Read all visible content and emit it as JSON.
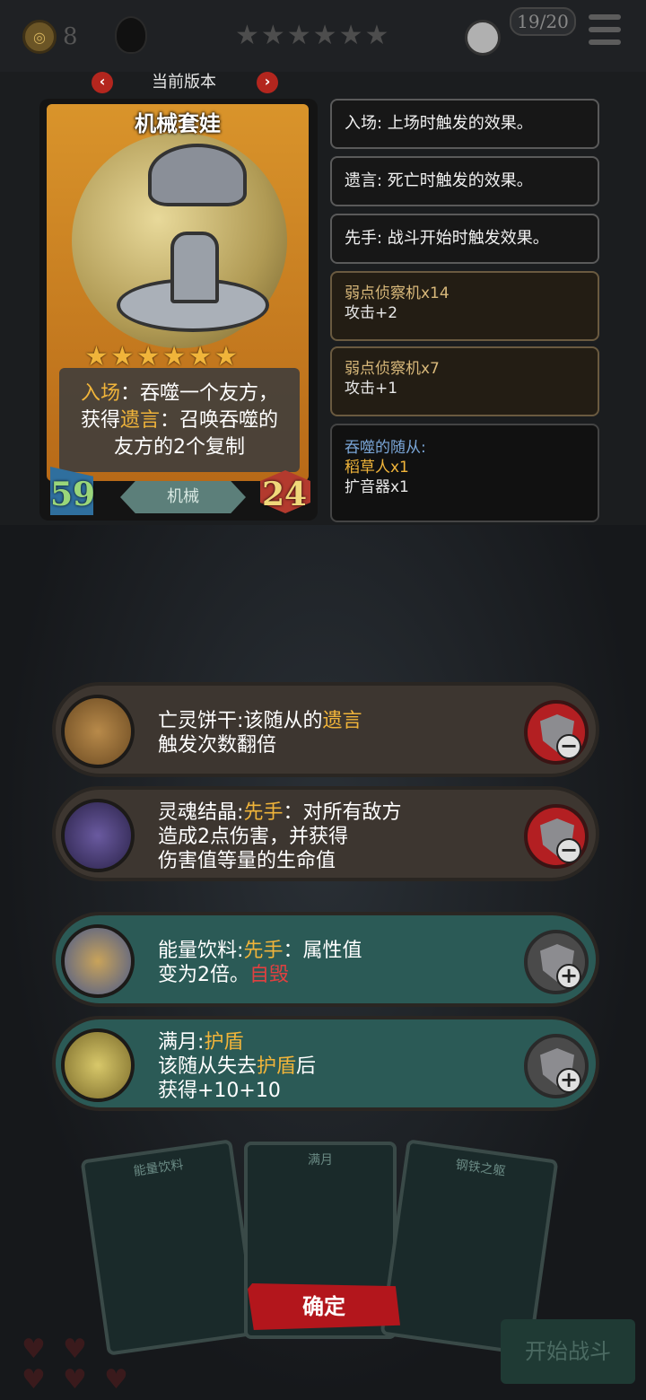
{
  "topbar": {
    "coins": "8",
    "stars": "★★★★★★",
    "slots": "19/20"
  },
  "version": {
    "label": "当前版本",
    "prev": "‹",
    "next": "›"
  },
  "card": {
    "title": "机械套娃",
    "stars": "★★★★★★",
    "text_line1_kw": "入场",
    "text_line1_rest": "：吞噬一个友方，",
    "text_line2_pre": "获得",
    "text_line2_kw": "遗言",
    "text_line2_rest": "：召唤吞噬的",
    "text_line3": "友方的2个复制",
    "attack": "59",
    "health": "24",
    "tribe": "机械"
  },
  "keywords": [
    {
      "text": "入场: 上场时触发的效果。"
    },
    {
      "text": "遗言: 死亡时触发的效果。"
    },
    {
      "text": "先手: 战斗开始时触发效果。"
    }
  ],
  "bonuses": [
    {
      "name": "弱点侦察机x14",
      "effect": "攻击+2"
    },
    {
      "name": "弱点侦察机x7",
      "effect": "攻击+1"
    }
  ],
  "devoured": {
    "title": "吞噬的随从:",
    "item1": "稻草人x1",
    "item2": "扩音器x1"
  },
  "items": [
    {
      "name": "亡灵饼干",
      "sep": ":",
      "pre": "该随从的",
      "kw": "遗言",
      "line2": "触发次数翻倍",
      "button": "−"
    },
    {
      "name": "灵魂结晶",
      "sep": ":",
      "kw": "先手",
      "rest": "：对所有敌方",
      "line2": "造成2点伤害，并获得",
      "line3": "伤害值等量的生命值",
      "button": "−"
    },
    {
      "name": "能量饮料",
      "sep": ":",
      "kw": "先手",
      "rest": "：属性值",
      "line2_pre": "变为2倍。",
      "line2_kw": "自毁",
      "button": "+"
    },
    {
      "name": "满月",
      "sep": ":",
      "kw": "护盾",
      "line2_pre": "该随从失去",
      "line2_kw": "护盾",
      "line2_rest": "后",
      "line3": "获得+10+10",
      "button": "+"
    }
  ],
  "bottom_cards": [
    {
      "title": "能量饮料"
    },
    {
      "title": "满月"
    },
    {
      "title": "钢铁之躯"
    }
  ],
  "confirm": "确定",
  "start": "开始战斗",
  "colors": {
    "gold": "#f0b43a",
    "red": "#e04040",
    "confirm": "#b3161c",
    "item_green": "#2b5a56",
    "item_brown": "#3d3630"
  }
}
